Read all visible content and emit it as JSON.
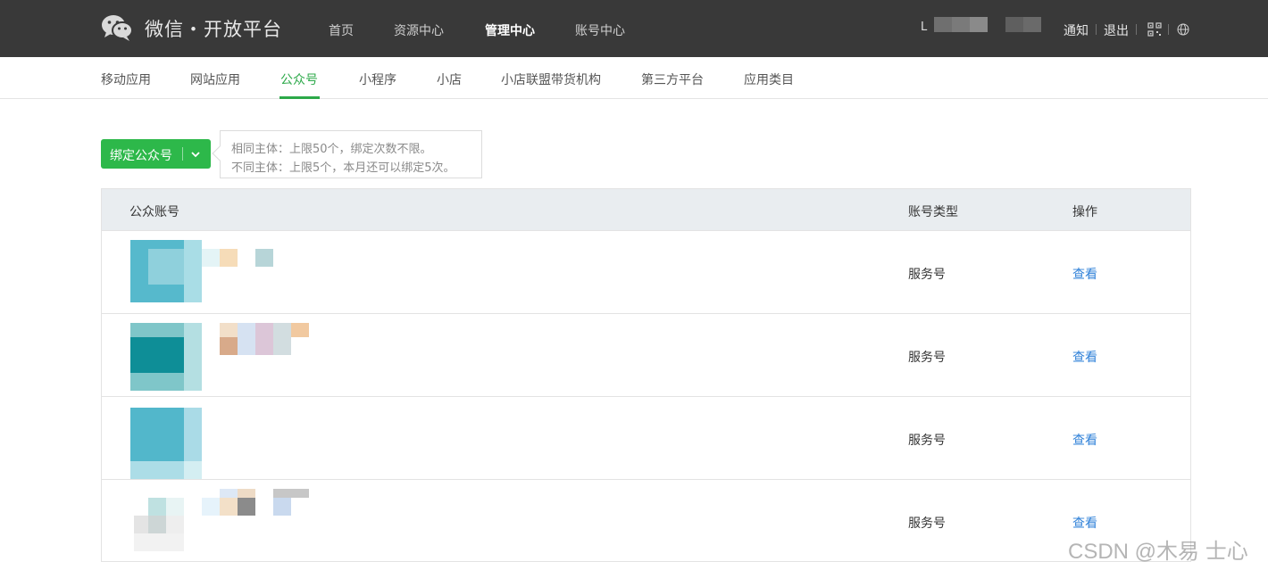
{
  "topbar": {
    "brand": "微信・开放平台",
    "nav": [
      "首页",
      "资源中心",
      "管理中心",
      "账号中心"
    ],
    "active_nav": "管理中心",
    "user_prefix": "L",
    "notify": "通知",
    "logout": "退出",
    "icons": [
      "wechat-logo",
      "qr-code-icon",
      "globe-icon"
    ]
  },
  "subnav": {
    "tabs": [
      "移动应用",
      "网站应用",
      "公众号",
      "小程序",
      "小店",
      "小店联盟带货机构",
      "第三方平台",
      "应用类目"
    ],
    "active_tab": "公众号"
  },
  "bind": {
    "button_label": "绑定公众号",
    "tip_line1": "相同主体：上限50个，绑定次数不限。",
    "tip_line2": "不同主体：上限5个，本月还可以绑定5次。"
  },
  "table": {
    "headers": {
      "account": "公众账号",
      "type": "账号类型",
      "action": "操作"
    },
    "rows": [
      {
        "type": "服务号",
        "action": "查看"
      },
      {
        "type": "服务号",
        "action": "查看"
      },
      {
        "type": "服务号",
        "action": "查看"
      },
      {
        "type": "服务号",
        "action": "查看"
      }
    ]
  },
  "watermark": "CSDN @木易 士心",
  "colors": {
    "topbar": "#393939",
    "accent_green": "#2db84a",
    "link_blue": "#2e80d8",
    "header_bg": "#e9edf0"
  }
}
